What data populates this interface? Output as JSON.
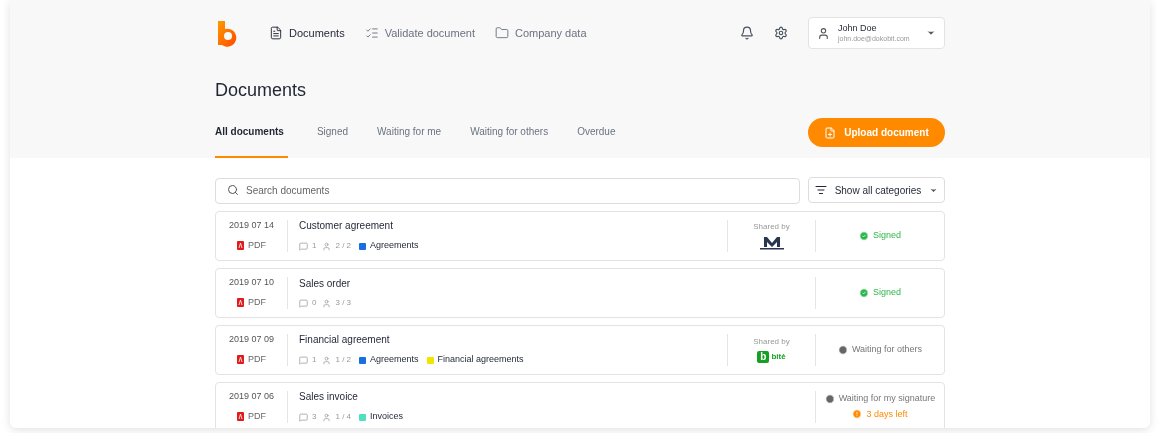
{
  "nav": {
    "items": [
      {
        "label": "Documents",
        "selected": true
      },
      {
        "label": "Validate document",
        "selected": false
      },
      {
        "label": "Company data",
        "selected": false
      }
    ],
    "user": {
      "name": "John Doe",
      "email": "john.doe@dokobit.com"
    }
  },
  "page": {
    "title": "Documents",
    "upload_button": "Upload document"
  },
  "tabs": [
    {
      "label": "All documents",
      "selected": true
    },
    {
      "label": "Signed",
      "selected": false
    },
    {
      "label": "Waiting for me",
      "selected": false
    },
    {
      "label": "Waiting for others",
      "selected": false
    },
    {
      "label": "Overdue",
      "selected": false
    }
  ],
  "search": {
    "placeholder": "Search documents"
  },
  "filter": {
    "label": "Show all categories"
  },
  "documents": [
    {
      "date": "2019 07 14",
      "file_type": "PDF",
      "title": "Customer agreement",
      "comments": "1",
      "signers": "2 / 2",
      "tags": [
        {
          "label": "Agreements",
          "color": "#1a6fe0"
        }
      ],
      "shared_by": {
        "label": "Shared by",
        "kind": "mark"
      },
      "status": {
        "kind": "signed",
        "label": "Signed"
      }
    },
    {
      "date": "2019 07 10",
      "file_type": "PDF",
      "title": "Sales order",
      "comments": "0",
      "signers": "3 / 3",
      "status": {
        "kind": "signed",
        "label": "Signed"
      }
    },
    {
      "date": "2019 07 09",
      "file_type": "PDF",
      "title": "Financial agreement",
      "comments": "1",
      "signers": "1 / 2",
      "tags": [
        {
          "label": "Agreements",
          "color": "#1a6fe0"
        },
        {
          "label": "Financial agreements",
          "color": "#f2e600"
        }
      ],
      "shared_by": {
        "label": "Shared by",
        "kind": "badge",
        "logo_letter": "b",
        "logo_text": "bitė"
      },
      "status": {
        "kind": "waiting",
        "label": "Waiting for others"
      }
    },
    {
      "date": "2019 07 06",
      "file_type": "PDF",
      "title": "Sales invoice",
      "comments": "3",
      "signers": "1 / 4",
      "tags": [
        {
          "label": "Invoices",
          "color": "#4fe0c0"
        }
      ],
      "status": {
        "kind": "waiting",
        "label": "Waiting for my signature",
        "note": "3 days left"
      }
    }
  ]
}
